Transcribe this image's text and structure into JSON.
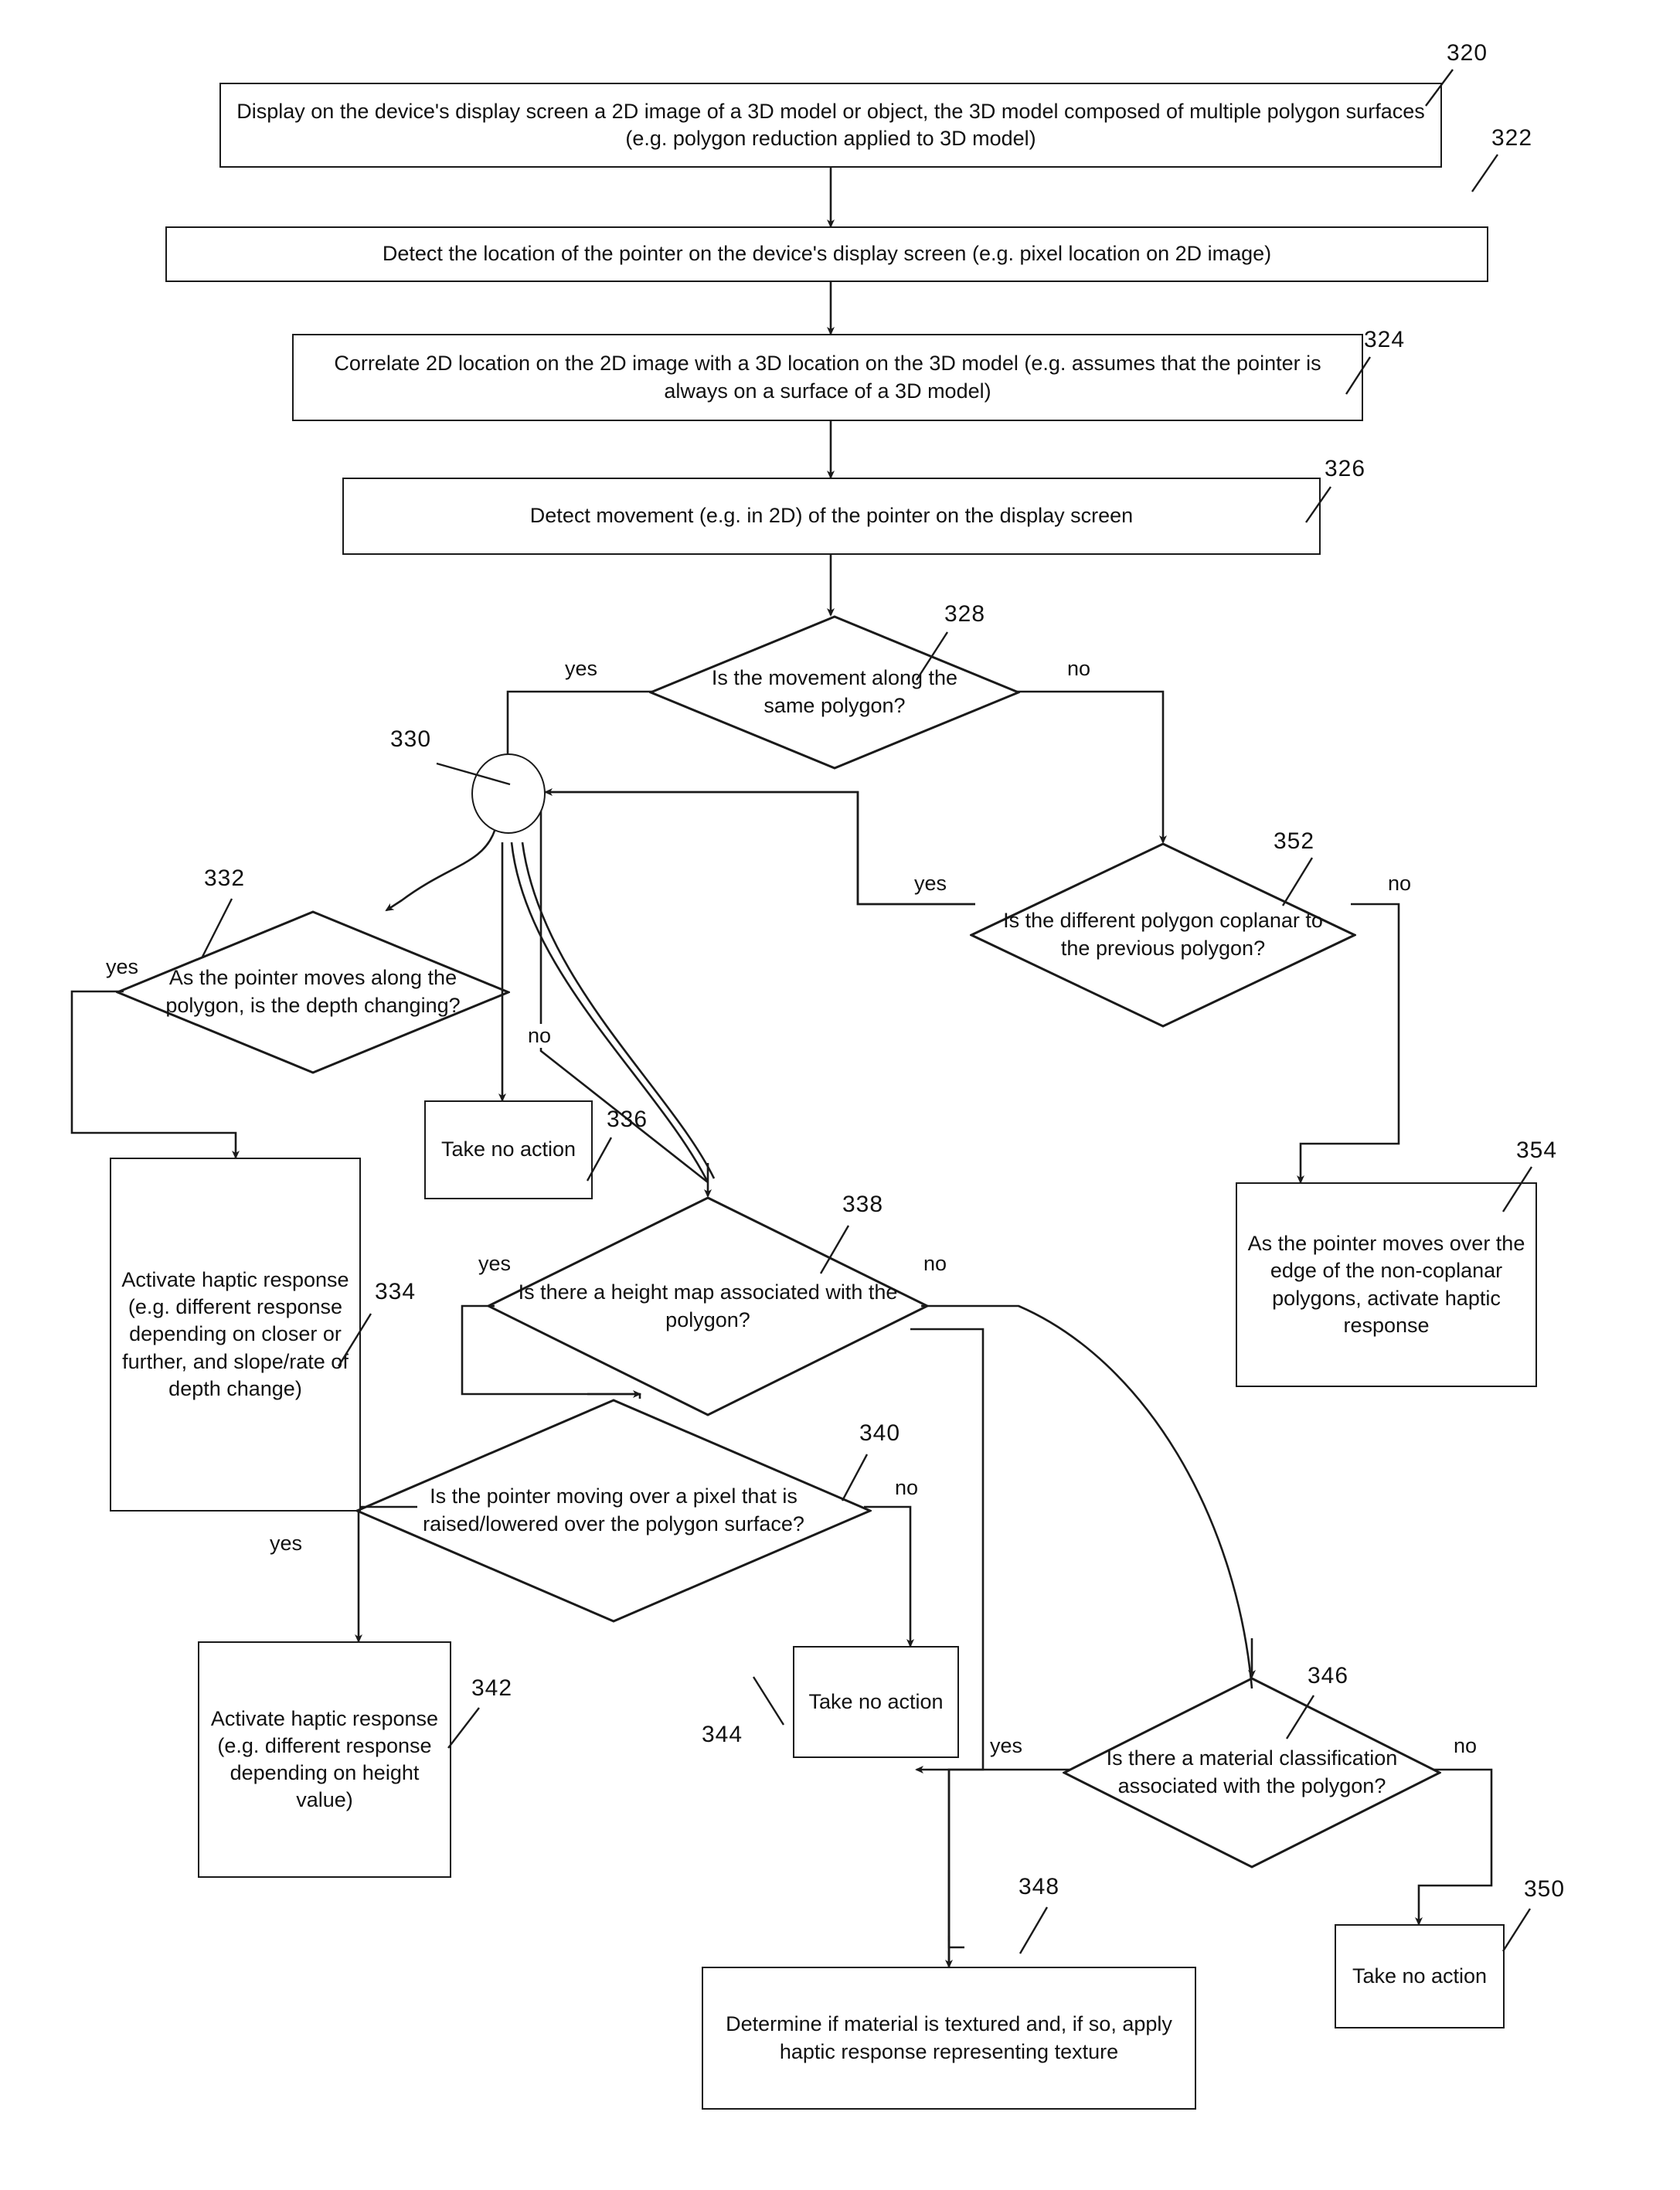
{
  "figure": {
    "type": "patent-flowchart",
    "nodes": [
      {
        "ref": "320",
        "shape": "process",
        "text": "Display on the device's display screen a 2D image of a 3D model or object, the 3D model composed of multiple polygon surfaces (e.g. polygon reduction applied to 3D model)"
      },
      {
        "ref": "322",
        "shape": "process",
        "text": "Detect the location of the pointer on the device's display screen (e.g. pixel location on 2D image)"
      },
      {
        "ref": "324",
        "shape": "process",
        "text": "Correlate 2D location on the 2D image with a 3D location on the 3D model (e.g. assumes that the pointer is always on a surface of a 3D model)"
      },
      {
        "ref": "326",
        "shape": "process",
        "text": "Detect movement (e.g. in 2D) of the pointer on the display screen"
      },
      {
        "ref": "328",
        "shape": "decision",
        "text": "Is the movement along the same polygon?"
      },
      {
        "ref": "330",
        "shape": "connector",
        "text": ""
      },
      {
        "ref": "332",
        "shape": "decision",
        "text": "As the pointer moves along the polygon, is the depth changing?"
      },
      {
        "ref": "334",
        "shape": "process",
        "text": "Activate haptic response (e.g. different response depending on closer or further, and slope/rate of depth change)"
      },
      {
        "ref": "336",
        "shape": "process",
        "text": "Take no action"
      },
      {
        "ref": "338",
        "shape": "decision",
        "text": "Is there a height map associated with the polygon?"
      },
      {
        "ref": "340",
        "shape": "decision",
        "text": "Is the pointer moving over a pixel that is raised/lowered over the polygon surface?"
      },
      {
        "ref": "342",
        "shape": "process",
        "text": "Activate haptic response (e.g. different response depending on height value)"
      },
      {
        "ref": "344",
        "shape": "process",
        "text": "Take no action"
      },
      {
        "ref": "346",
        "shape": "decision",
        "text": "Is there a material classification associated with the polygon?"
      },
      {
        "ref": "348",
        "shape": "process",
        "text": "Determine if material is textured and, if so, apply haptic response representing texture"
      },
      {
        "ref": "350",
        "shape": "process",
        "text": "Take no action"
      },
      {
        "ref": "352",
        "shape": "decision",
        "text": "Is the different polygon coplanar to the previous polygon?"
      },
      {
        "ref": "354",
        "shape": "process",
        "text": "As the pointer moves over the edge of the non-coplanar polygons, activate haptic response"
      }
    ],
    "edge_labels": {
      "d328_yes": "yes",
      "d328_no": "no",
      "d332_yes": "yes",
      "d332_no": "no",
      "d338_yes": "yes",
      "d338_no": "no",
      "d340_yes": "yes",
      "d340_no": "no",
      "d346_yes": "yes",
      "d346_no": "no",
      "d352_yes": "yes",
      "d352_no": "no"
    },
    "ref_labels": {
      "r320": "320",
      "r322": "322",
      "r324": "324",
      "r326": "326",
      "r328": "328",
      "r330": "330",
      "r332": "332",
      "r334": "334",
      "r336": "336",
      "r338": "338",
      "r340": "340",
      "r342": "342",
      "r344": "344",
      "r346": "346",
      "r348": "348",
      "r350": "350",
      "r352": "352",
      "r354": "354"
    },
    "box_text": {
      "b320": "Display on the device's display screen a 2D image of a 3D model or object, the 3D model composed of multiple polygon surfaces (e.g. polygon reduction applied to 3D model)",
      "b322": "Detect the location of the pointer on the device's display screen (e.g. pixel location on 2D image)",
      "b324": "Correlate 2D location on the 2D image with a 3D location on the 3D model (e.g. assumes that the pointer is always on a surface of a 3D model)",
      "b326": "Detect movement (e.g. in 2D) of the pointer on the display screen",
      "b334": "Activate haptic response (e.g. different response depending on closer or further, and slope/rate of depth change)",
      "b336": "Take no action",
      "b342": "Activate haptic response (e.g. different response depending on height value)",
      "b344": "Take no action",
      "b348": "Determine if material is textured and, if so, apply haptic response representing texture",
      "b350": "Take no action",
      "b354": "As the pointer moves over the edge of the non-coplanar polygons, activate haptic response"
    },
    "diamond_text": {
      "d328": "Is the movement along the same polygon?",
      "d332": "As the pointer moves along the polygon, is the depth changing?",
      "d338": "Is there a height map associated with the polygon?",
      "d340": "Is the pointer moving over a pixel that is raised/lowered over the polygon surface?",
      "d346": "Is there a material classification associated with the polygon?",
      "d352": "Is the different polygon coplanar to the previous polygon?"
    },
    "colors": {
      "line": "#1a1a1a",
      "text": "#111111",
      "background": "#ffffff"
    }
  }
}
